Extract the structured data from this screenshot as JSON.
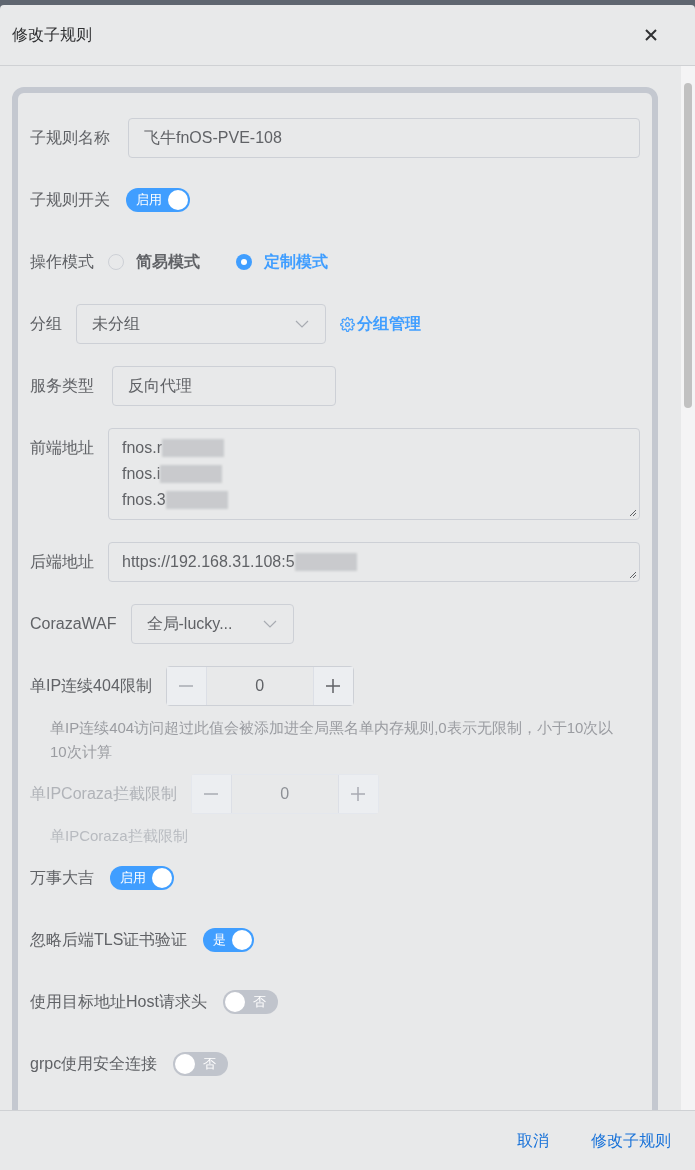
{
  "dialog": {
    "title": "修改子规则"
  },
  "form": [
    {
      "kind": "input",
      "label": "子规则名称",
      "value": "飞牛fnOS-PVE-108"
    },
    {
      "kind": "switch",
      "label": "子规则开关",
      "on": true,
      "text": "启用"
    },
    {
      "kind": "radio",
      "label": "操作模式",
      "options": [
        {
          "label": "简易模式",
          "selected": false
        },
        {
          "label": "定制模式",
          "selected": true
        }
      ]
    },
    {
      "kind": "select",
      "label": "分组",
      "value": "未分组",
      "link": "分组管理"
    },
    {
      "kind": "compact_input",
      "label": "服务类型",
      "value": "反向代理"
    },
    {
      "kind": "textarea",
      "label": "前端地址",
      "lines": [
        "fnos.r",
        "fnos.i",
        "fnos.3"
      ]
    },
    {
      "kind": "textarea",
      "label": "后端地址",
      "lines": [
        "https://192.168.31.108:5"
      ]
    },
    {
      "kind": "compact_select",
      "label": "CorazaWAF",
      "value": "全局-lucky..."
    },
    {
      "kind": "number",
      "label": "单IP连续404限制",
      "value": "0",
      "disabled": false
    },
    {
      "kind": "hint",
      "text": "单IP连续404访问超过此值会被添加进全局黑名单内存规则,0表示无限制，小于10次以10次计算",
      "disabled": false
    },
    {
      "kind": "number",
      "label": "单IPCoraza拦截限制",
      "value": "0",
      "disabled": true
    },
    {
      "kind": "hint",
      "text": "单IPCoraza拦截限制",
      "disabled": true
    },
    {
      "kind": "switch",
      "label": "万事大吉",
      "on": true,
      "text": "启用"
    },
    {
      "kind": "switch",
      "label": "忽略后端TLS证书验证",
      "on": true,
      "text": "是"
    },
    {
      "kind": "switch",
      "label": "使用目标地址Host请求头",
      "on": false,
      "text": "否"
    },
    {
      "kind": "switch",
      "label": "grpc使用安全连接",
      "on": false,
      "text": "否"
    }
  ],
  "footer": {
    "buttons": [
      {
        "label": "取消"
      },
      {
        "label": "修改子规则"
      }
    ]
  }
}
